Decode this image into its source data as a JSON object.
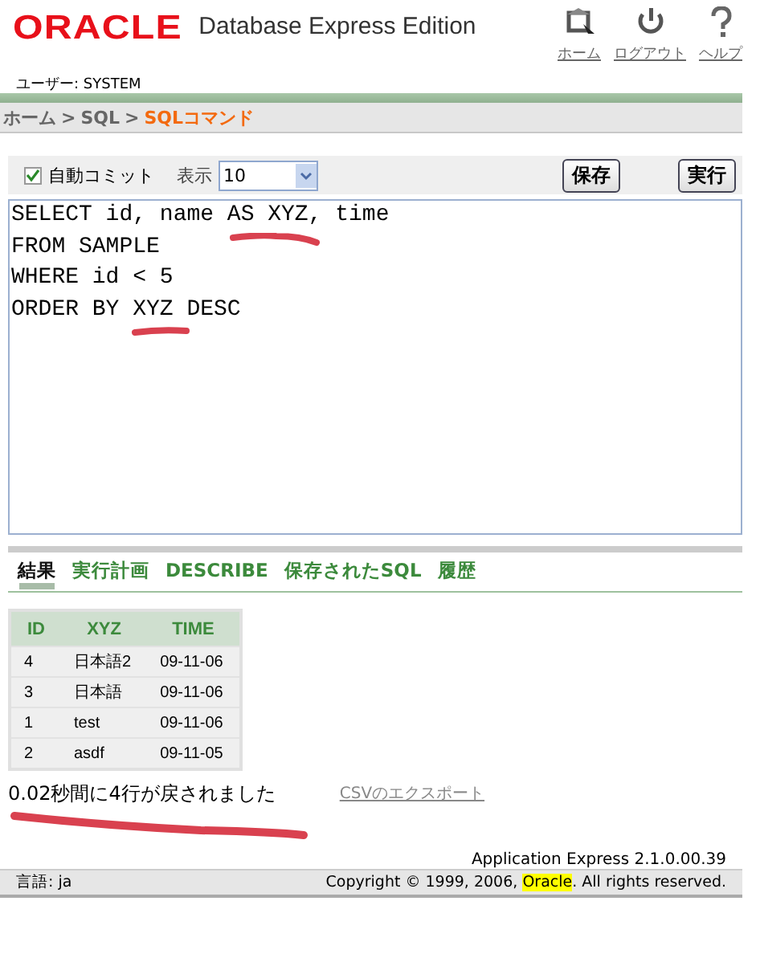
{
  "header": {
    "logo": "ORACLE",
    "product": "Database Express Edition",
    "links": [
      {
        "kind": "home",
        "label": "ホーム"
      },
      {
        "kind": "logout",
        "label": "ログアウト"
      },
      {
        "kind": "help",
        "label": "ヘルプ"
      }
    ]
  },
  "user": "ユーザー: SYSTEM",
  "breadcrumb": [
    {
      "label": "ホーム",
      "current": false
    },
    {
      "label": "SQL",
      "current": false
    },
    {
      "label": "SQLコマンド",
      "current": true
    }
  ],
  "breadcrumb_separator": ">",
  "toolbar": {
    "autocommit": {
      "label": "自動コミット",
      "checked": true
    },
    "display_label": "表示",
    "display_value": "10",
    "buttons": [
      "保存",
      "実行"
    ]
  },
  "editor": {
    "lines": [
      "SELECT id, name AS XYZ, time",
      "FROM SAMPLE",
      "WHERE id < 5",
      "ORDER BY XYZ DESC"
    ]
  },
  "tabs": [
    {
      "label": "結果",
      "selected": true
    },
    {
      "label": "実行計画",
      "selected": false
    },
    {
      "label": "DESCRIBE",
      "selected": false
    },
    {
      "label": "保存されたSQL",
      "selected": false
    },
    {
      "label": "履歴",
      "selected": false
    }
  ],
  "table": {
    "columns": [
      "ID",
      "XYZ",
      "TIME"
    ],
    "rows": [
      [
        "4",
        "日本語2",
        "09-11-06"
      ],
      [
        "3",
        "日本語",
        "09-11-06"
      ],
      [
        "1",
        "test",
        "09-11-06"
      ],
      [
        "2",
        "asdf",
        "09-11-05"
      ]
    ]
  },
  "message": "0.02秒間に4行が戻されました",
  "export_link": "CSVのエクスポート",
  "version": "Application Express 2.1.0.00.39",
  "footer": {
    "language": "言語: ja",
    "copyright": "Copyright © 1999, 2006, **Oracle**. All rights reserved."
  }
}
